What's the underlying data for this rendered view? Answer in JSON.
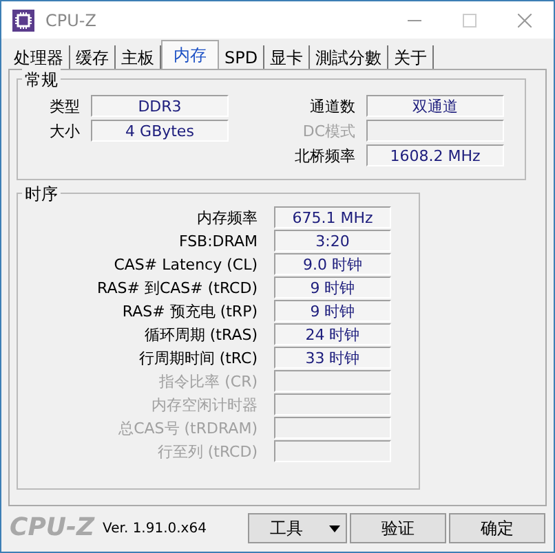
{
  "window": {
    "title": "CPU-Z"
  },
  "tabs": [
    {
      "label": "处理器",
      "selected": false
    },
    {
      "label": "缓存",
      "selected": false
    },
    {
      "label": "主板",
      "selected": false
    },
    {
      "label": "内存",
      "selected": true
    },
    {
      "label": "SPD",
      "selected": false
    },
    {
      "label": "显卡",
      "selected": false
    },
    {
      "label": "測試分數",
      "selected": false
    },
    {
      "label": "关于",
      "selected": false
    }
  ],
  "general": {
    "title": "常规",
    "left": [
      {
        "label": "类型",
        "value": "DDR3",
        "disabled": false
      },
      {
        "label": "大小",
        "value": "4 GBytes",
        "disabled": false
      }
    ],
    "right": [
      {
        "label": "通道数",
        "value": "双通道",
        "disabled": false
      },
      {
        "label": "DC模式",
        "disabled": true
      },
      {
        "label": "北桥频率",
        "value": "1608.2 MHz",
        "disabled": false
      }
    ]
  },
  "timings": {
    "title": "时序",
    "rows": [
      {
        "label": "内存频率",
        "value": "675.1 MHz",
        "disabled": false
      },
      {
        "label": "FSB:DRAM",
        "value": "3:20",
        "disabled": false
      },
      {
        "label": "CAS# Latency (CL)",
        "value": "9.0 时钟",
        "disabled": false
      },
      {
        "label": "RAS# 到CAS# (tRCD)",
        "value": "9 时钟",
        "disabled": false
      },
      {
        "label": "RAS# 预充电 (tRP)",
        "value": "9 时钟",
        "disabled": false
      },
      {
        "label": "循环周期 (tRAS)",
        "value": "24 时钟",
        "disabled": false
      },
      {
        "label": "行周期时间 (tRC)",
        "value": "33 时钟",
        "disabled": false
      },
      {
        "label": "指令比率 (CR)",
        "disabled": true
      },
      {
        "label": "内存空闲计时器",
        "disabled": true
      },
      {
        "label": "总CAS号 (tRDRAM)",
        "disabled": true
      },
      {
        "label": "行至列 (tRCD)",
        "disabled": true
      }
    ]
  },
  "footer": {
    "logo": "CPU-Z",
    "version": "Ver. 1.91.0.x64",
    "buttons": [
      {
        "label": "工具",
        "kind": "dropdown"
      },
      {
        "label": "验证",
        "kind": "plain"
      },
      {
        "label": "确定",
        "kind": "plain"
      }
    ]
  }
}
